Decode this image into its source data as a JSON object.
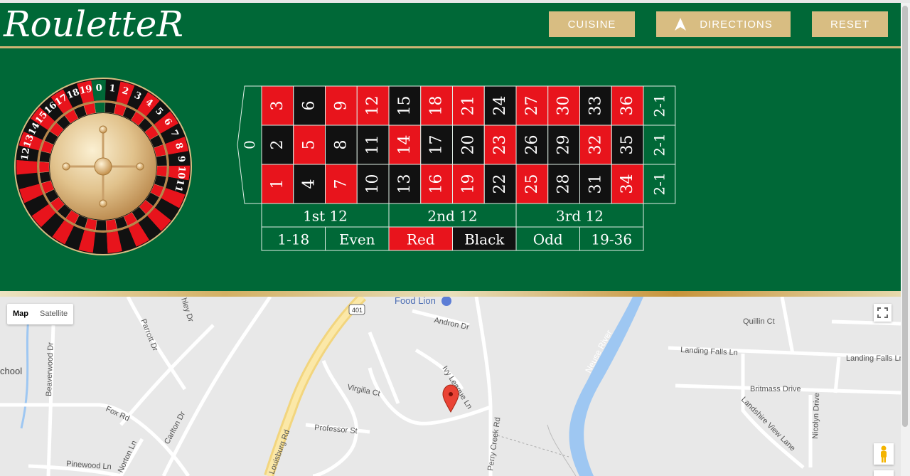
{
  "app": {
    "title": "RouletteR"
  },
  "header": {
    "buttons": [
      {
        "label": "CUISINE",
        "icon": ""
      },
      {
        "label": "DIRECTIONS",
        "icon": "navigation-arrow-icon"
      },
      {
        "label": "RESET",
        "icon": ""
      }
    ]
  },
  "wheel": {
    "numbers": [
      "0",
      "1",
      "2",
      "3",
      "4",
      "5",
      "6",
      "7",
      "8",
      "9",
      "10",
      "11",
      "12",
      "13",
      "14",
      "15",
      "16",
      "17",
      "18",
      "19"
    ],
    "colors": {
      "red": "#e8141c",
      "black": "#111111",
      "green": "#006837"
    }
  },
  "table": {
    "zero": "0",
    "rows": [
      [
        "3",
        "6",
        "9",
        "12",
        "15",
        "18",
        "21",
        "24",
        "27",
        "30",
        "33",
        "36"
      ],
      [
        "2",
        "5",
        "8",
        "11",
        "14",
        "17",
        "20",
        "23",
        "26",
        "29",
        "32",
        "35"
      ],
      [
        "1",
        "4",
        "7",
        "10",
        "13",
        "16",
        "19",
        "22",
        "25",
        "28",
        "31",
        "34"
      ]
    ],
    "red_numbers": [
      "1",
      "3",
      "5",
      "7",
      "9",
      "12",
      "14",
      "16",
      "18",
      "19",
      "21",
      "23",
      "25",
      "27",
      "30",
      "32",
      "34",
      "36"
    ],
    "columns": [
      "2-1",
      "2-1",
      "2-1"
    ],
    "dozens": [
      "1st 12",
      "2nd 12",
      "3rd 12"
    ],
    "outside": [
      "1-18",
      "Even",
      "Red",
      "Black",
      "Odd",
      "19-36"
    ]
  },
  "map": {
    "type_buttons": [
      "Map",
      "Satellite"
    ],
    "active_type": "Map",
    "labels": {
      "food_lion": "Food Lion",
      "andron_dr": "Andron Dr",
      "quillin_ct": "Quillin Ct",
      "landing_falls_ln": "Landing Falls Ln",
      "landing_falls_ln2": "Landing Falls Ln",
      "britmass_drive": "Britmass Drive",
      "landshire_view_lane": "Landshire View Lane",
      "nicolyn_drive": "Nicolyn Drive",
      "neuse_river": "Neuse River",
      "ivy_league_ln": "Ivy League Ln",
      "virgilia_ct": "Virgilia Ct",
      "professor_st": "Professor St",
      "perry_creek_rd": "Perry Creek Rd",
      "louisburg_rd": "Louisburg Rd",
      "route_401": "401",
      "parrott_dr": "Parrott Dr",
      "beaverwood_dr": "Beaverwood Dr",
      "ashley_dr": "hley Dr",
      "school": "chool",
      "fox_rd": "Fox Rd",
      "carlton_dr": "Carlton Dr",
      "norton_ln": "Norton Ln",
      "pinewood_ln": "Pinewood Ln"
    }
  }
}
